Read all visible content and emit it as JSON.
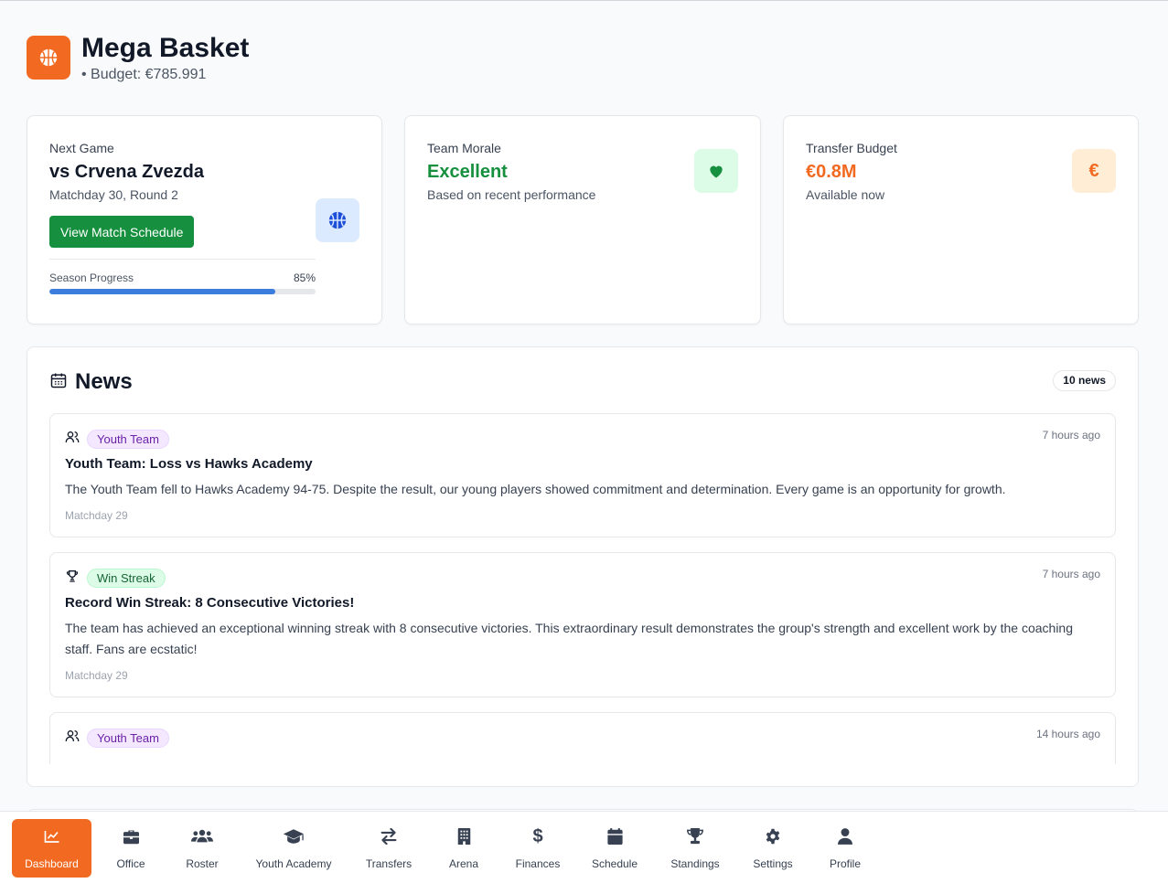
{
  "app": {
    "title": "Mega Basket",
    "budget": "• Budget: €785.991",
    "brand_color": "#f26a21",
    "logo_icon": "basketball-icon"
  },
  "cards": {
    "next_game": {
      "label": "Next Game",
      "opponent": "vs Crvena Zvezda",
      "subtitle": "Matchday 30, Round 2",
      "button": "View Match Schedule",
      "progress_label": "Season Progress",
      "progress_text": "85%",
      "progress_value": 0.85,
      "icon": "basketball-icon"
    },
    "morale": {
      "label": "Team Morale",
      "value": "Excellent",
      "subtitle": "Based on recent performance",
      "value_color": "#16903e",
      "icon": "heart-icon"
    },
    "transfer": {
      "label": "Transfer Budget",
      "value": "€0.8M",
      "subtitle": "Available now",
      "value_color": "#f26a21",
      "icon": "euro-icon",
      "icon_text": "€"
    }
  },
  "news": {
    "title": "News",
    "count": "10 news",
    "items": [
      {
        "icon": "users-icon",
        "tag": "Youth Team",
        "time": "7 hours ago",
        "title": "Youth Team: Loss vs Hawks Academy",
        "body": "The Youth Team fell to Hawks Academy 94-75. Despite the result, our young players showed commitment and determination. Every game is an opportunity for growth.",
        "meta": "Matchday 29"
      },
      {
        "icon": "trophy-icon",
        "tag": "Win Streak",
        "time": "7 hours ago",
        "title": "Record Win Streak: 8 Consecutive Victories!",
        "body": "The team has achieved an exceptional winning streak with 8 consecutive victories. This extraordinary result demonstrates the group's strength and excellent work by the coaching staff. Fans are ecstatic!",
        "meta": "Matchday 29"
      },
      {
        "icon": "users-icon",
        "tag": "Youth Team",
        "time": "14 hours ago",
        "title": "",
        "body": "",
        "meta": ""
      }
    ]
  },
  "nav": [
    {
      "label": "Dashboard",
      "icon": "chart-line-icon",
      "active": true
    },
    {
      "label": "Office",
      "icon": "briefcase-icon"
    },
    {
      "label": "Roster",
      "icon": "users-icon"
    },
    {
      "label": "Youth Academy",
      "icon": "graduation-cap-icon"
    },
    {
      "label": "Transfers",
      "icon": "exchange-icon"
    },
    {
      "label": "Arena",
      "icon": "building-icon"
    },
    {
      "label": "Finances",
      "icon": "dollar-icon",
      "glyph": "$"
    },
    {
      "label": "Schedule",
      "icon": "calendar-icon"
    },
    {
      "label": "Standings",
      "icon": "trophy-icon"
    },
    {
      "label": "Settings",
      "icon": "gear-icon"
    },
    {
      "label": "Profile",
      "icon": "user-icon"
    }
  ]
}
